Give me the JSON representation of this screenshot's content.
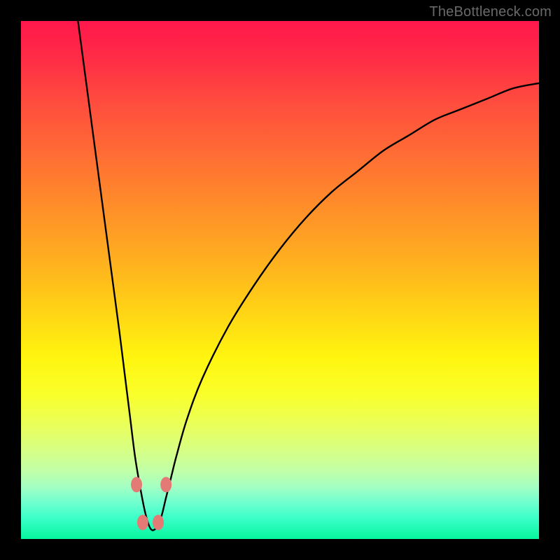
{
  "watermark": "TheBottleneck.com",
  "colors": {
    "background": "#000000",
    "gradient_top": "#ff174b",
    "gradient_bottom": "#07f59e",
    "curve_stroke": "#000000",
    "dot_fill": "#e47a76"
  },
  "chart_data": {
    "type": "line",
    "title": "",
    "xlabel": "",
    "ylabel": "",
    "xlim": [
      0,
      100
    ],
    "ylim": [
      0,
      100
    ],
    "grid": false,
    "legend": false,
    "note": "No axes or tick labels are rendered. Curve values estimated from pixel positions; y ≈ 0 indicates bottom (green), y ≈ 100 indicates top (red). Minimum (bottleneck sweet spot) near x ≈ 25.",
    "series": [
      {
        "name": "bottleneck-curve",
        "x": [
          11,
          13,
          15,
          17,
          19,
          20,
          21,
          22,
          23,
          24,
          25,
          26,
          27,
          28,
          29,
          30,
          32,
          35,
          40,
          45,
          50,
          55,
          60,
          65,
          70,
          75,
          80,
          85,
          90,
          95,
          100
        ],
        "y": [
          100,
          85,
          70,
          55,
          40,
          32,
          24,
          16,
          10,
          5,
          2,
          2,
          4,
          8,
          12,
          16,
          23,
          31,
          41,
          49,
          56,
          62,
          67,
          71,
          75,
          78,
          81,
          83,
          85,
          87,
          88
        ]
      }
    ],
    "markers": [
      {
        "x": 22.3,
        "y": 10.5
      },
      {
        "x": 23.5,
        "y": 3.2
      },
      {
        "x": 26.5,
        "y": 3.2
      },
      {
        "x": 28.0,
        "y": 10.5
      }
    ]
  }
}
